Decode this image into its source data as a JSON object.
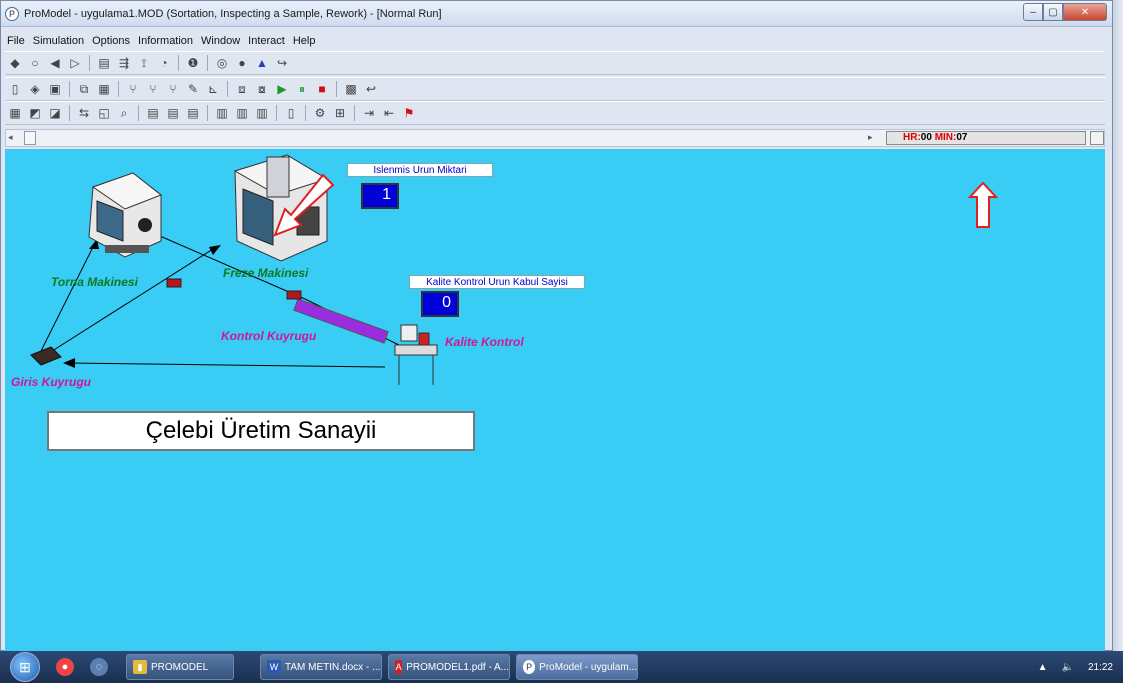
{
  "window": {
    "title": "ProModel - uygulama1.MOD (Sortation, Inspecting a Sample, Rework) - [Normal Run]",
    "app_icon": "promodel-icon"
  },
  "menu": {
    "items": [
      "File",
      "Simulation",
      "Options",
      "Information",
      "Window",
      "Interact",
      "Help"
    ]
  },
  "clock": {
    "hr_label": "HR:",
    "hr_value": "00",
    "min_label": "MIN:",
    "min_value": "07"
  },
  "layout": {
    "locations": {
      "torna": "Torna Makinesi",
      "freze": "Freze Makinesi",
      "kontrol_kuyrugu": "Kontrol Kuyrugu",
      "kalite_kontrol": "Kalite Kontrol",
      "giris_kuyrugu": "Giris Kuyrugu"
    },
    "counter1": {
      "title": "Islenmis Urun Miktari",
      "value": "1"
    },
    "counter2": {
      "title": "Kalite Kontrol Urun Kabul Sayisi",
      "value": "0"
    },
    "banner": "Çelebi Üretim Sanayii",
    "colors": {
      "background": "#39ccf5",
      "green_label": "#0f7a1f",
      "magenta_label": "#d0169a",
      "white_label": "#ffffff",
      "conveyor": "#9b2de0",
      "annotation_arrow": "#e02020"
    }
  },
  "taskbar": {
    "items": [
      {
        "label": "PROMODEL",
        "icon": "folder-icon"
      },
      {
        "label": "TAM METIN.docx - ...",
        "icon": "word-icon"
      },
      {
        "label": "PROMODEL1.pdf - A...",
        "icon": "pdf-icon"
      },
      {
        "label": "ProModel - uygulam...",
        "icon": "promodel-icon"
      }
    ],
    "time": "21:22"
  }
}
